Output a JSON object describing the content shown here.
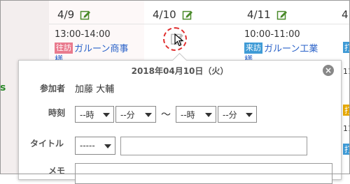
{
  "calendar": {
    "columns": [
      {
        "date": "4/9",
        "event": {
          "time": "13:00-14:00",
          "badge": "往訪",
          "title": "ガルーン商事",
          "more": "様"
        }
      },
      {
        "date": "4/10"
      },
      {
        "date": "4/11",
        "event": {
          "time": "10:00-11:00",
          "badge": "来訪",
          "title": "ガルーン工業",
          "more": "様"
        }
      },
      {
        "date": "4"
      }
    ],
    "left_fragment": "s",
    "edge_stubs": [
      "打",
      "11",
      "打",
      "11",
      "打"
    ]
  },
  "popup": {
    "date": "2018年04月10日（火）",
    "close_icon": "×",
    "attendee_label": "参加者",
    "attendee_value": "加藤 大輔",
    "time_label": "時刻",
    "start_hour": "--時",
    "start_min": "--分",
    "tilde": "～",
    "end_hour": "--時",
    "end_min": "--分",
    "title_label": "タイトル",
    "title_prefix": "-----",
    "title_value": "",
    "memo_label": "メモ"
  },
  "colors": {
    "visit_badge": "#e97a8d",
    "incoming_badge": "#3f9bd6",
    "link": "#2a62c9",
    "highlight": "#e03030"
  }
}
